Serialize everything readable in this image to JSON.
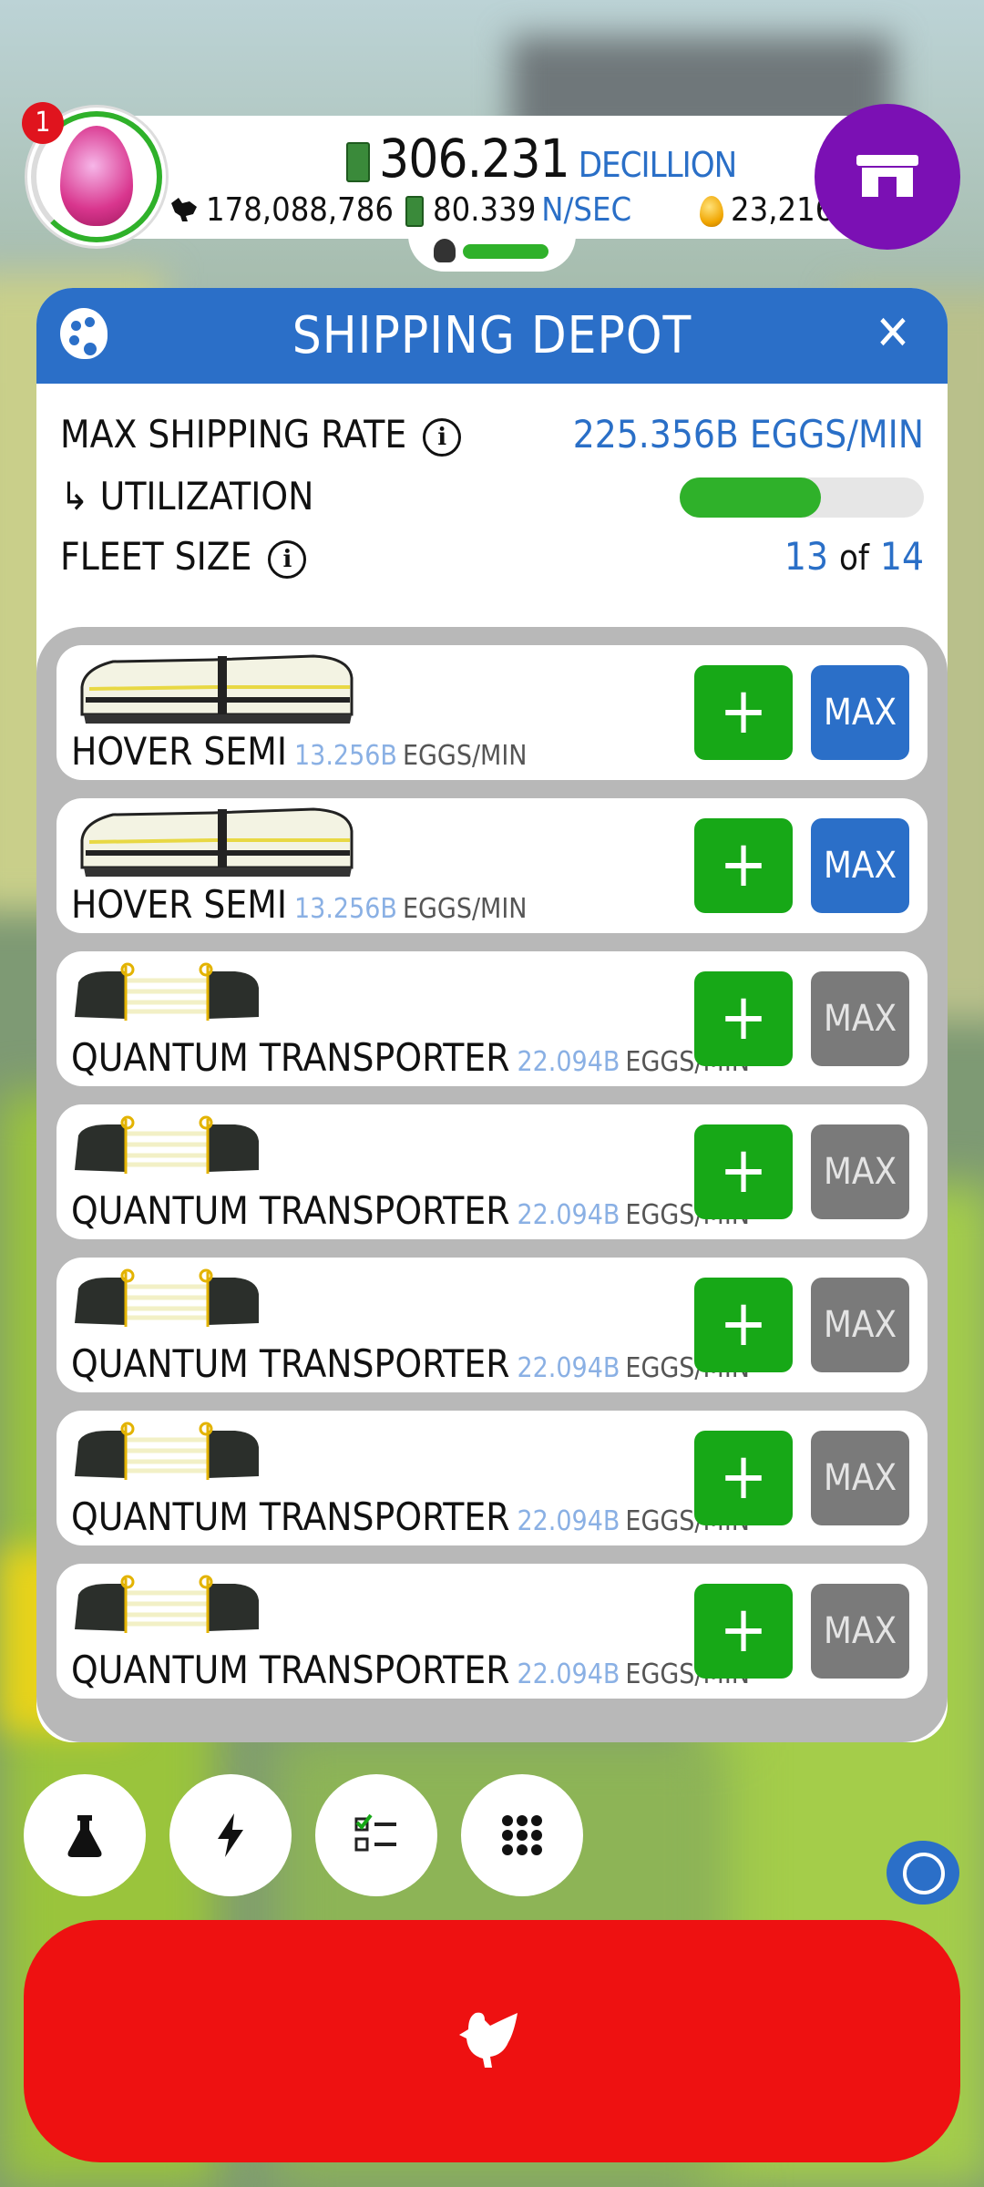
{
  "header": {
    "notification_count": "1",
    "cash_value": "306.231",
    "cash_unit": "DECILLION",
    "chicken_count": "178,088,786",
    "earning_rate": "80.339",
    "earning_rate_unit": "N/SEC",
    "golden_eggs": "23,216"
  },
  "panel": {
    "title": "SHIPPING DEPOT",
    "max_shipping_rate_label": "MAX SHIPPING RATE",
    "max_shipping_rate_value": "225.356B EGGS/MIN",
    "utilization_label": "↳ UTILIZATION",
    "utilization_fraction": 0.58,
    "fleet_size_label": "FLEET SIZE",
    "fleet_size_current": "13",
    "fleet_size_of": "of",
    "fleet_size_max": "14"
  },
  "vehicles": [
    {
      "name": "HOVER SEMI",
      "rate": "13.256B",
      "unit": "EGGS/MIN",
      "plus": "+",
      "max": "MAX"
    },
    {
      "name": "HOVER SEMI",
      "rate": "13.256B",
      "unit": "EGGS/MIN",
      "plus": "+",
      "max": "MAX"
    },
    {
      "name": "QUANTUM TRANSPORTER",
      "rate": "22.094B",
      "unit": "EGGS/MIN",
      "plus": "+",
      "max": "MAX"
    },
    {
      "name": "QUANTUM TRANSPORTER",
      "rate": "22.094B",
      "unit": "EGGS/MIN",
      "plus": "+",
      "max": "MAX"
    },
    {
      "name": "QUANTUM TRANSPORTER",
      "rate": "22.094B",
      "unit": "EGGS/MIN",
      "plus": "+",
      "max": "MAX"
    },
    {
      "name": "QUANTUM TRANSPORTER",
      "rate": "22.094B",
      "unit": "EGGS/MIN",
      "plus": "+",
      "max": "MAX"
    },
    {
      "name": "QUANTUM TRANSPORTER",
      "rate": "22.094B",
      "unit": "EGGS/MIN",
      "plus": "+",
      "max": "MAX"
    }
  ],
  "colors": {
    "accent_blue": "#2b6fc8",
    "add_green": "#17a817",
    "max_gray": "#7a7a7a",
    "shop_purple": "#7b10b4",
    "hatch_red": "#ee1111"
  },
  "icons": {
    "bottom_buttons": [
      "flask-icon",
      "lightning-icon",
      "checklist-icon",
      "grid-icon"
    ],
    "hatch": "chicken-icon",
    "shop": "shop-icon",
    "header_left": "palette-icon",
    "header_right": "close-icon"
  }
}
